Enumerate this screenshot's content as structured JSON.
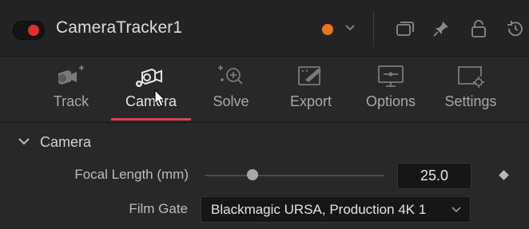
{
  "header": {
    "title": "CameraTracker1",
    "enabled": true,
    "color_tag": "#e8761d",
    "icons": [
      "node-toggle-icon",
      "color-dropdown-chevron-icon",
      "versions-icon",
      "pin-icon",
      "lock-icon",
      "reset-icon"
    ]
  },
  "tabs": [
    {
      "label": "Track",
      "icon": "track-icon",
      "active": false
    },
    {
      "label": "Camera",
      "icon": "camera-icon",
      "active": true
    },
    {
      "label": "Solve",
      "icon": "solve-icon",
      "active": false
    },
    {
      "label": "Export",
      "icon": "export-icon",
      "active": false
    },
    {
      "label": "Options",
      "icon": "options-icon",
      "active": false
    },
    {
      "label": "Settings",
      "icon": "settings-icon",
      "active": false
    }
  ],
  "section": {
    "title": "Camera",
    "expanded": true
  },
  "fields": {
    "focal_length": {
      "label": "Focal Length (mm)",
      "value": "25.0",
      "slider_fraction": 0.27
    },
    "film_gate": {
      "label": "Film Gate",
      "value": "Blackmagic URSA, Production 4K 1"
    }
  },
  "colors": {
    "accent": "#d9463c",
    "toggle_on": "#e0302c"
  }
}
